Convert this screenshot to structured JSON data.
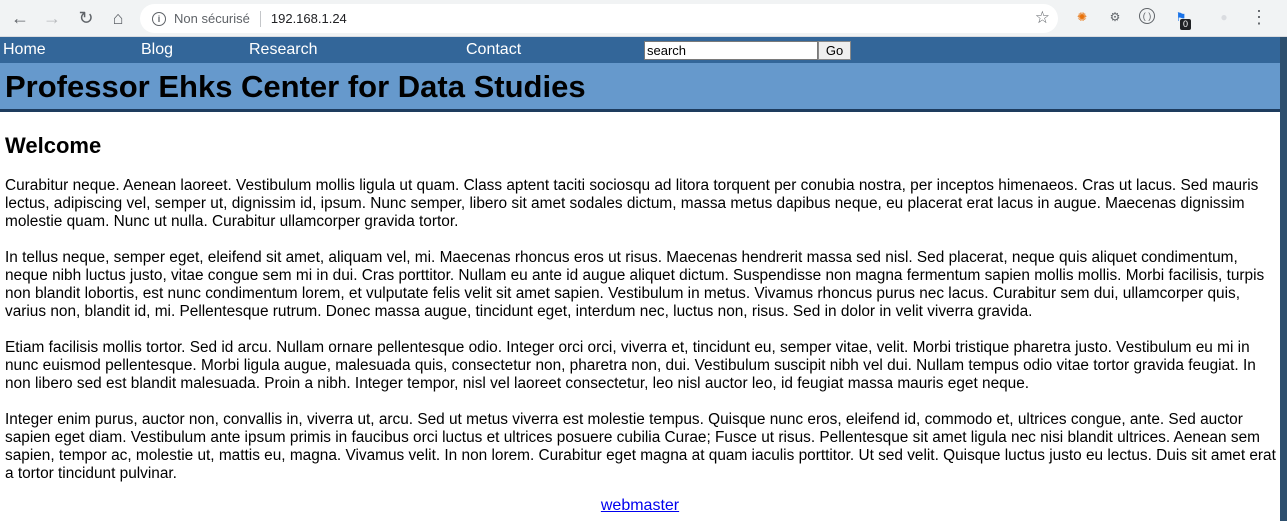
{
  "browser": {
    "security_label": "Non sécurisé",
    "url": "192.168.1.24",
    "extension_badge": "0",
    "icons": [
      "back-icon",
      "forward-icon",
      "reload-icon",
      "home-icon",
      "info-icon",
      "star-icon",
      "extension-icon",
      "menu-icon"
    ]
  },
  "nav": {
    "links": [
      "Home",
      "Blog",
      "Research",
      "Contact"
    ],
    "search_value": "search",
    "go_label": "Go"
  },
  "header": {
    "title": "Professor Ehks Center for Data Studies"
  },
  "main": {
    "heading": "Welcome",
    "paragraphs": [
      "Curabitur neque. Aenean laoreet. Vestibulum mollis ligula ut quam. Class aptent taciti sociosqu ad litora torquent per conubia nostra, per inceptos himenaeos. Cras ut lacus. Sed mauris lectus, adipiscing vel, semper ut, dignissim id, ipsum. Nunc semper, libero sit amet sodales dictum, massa metus dapibus neque, eu placerat erat lacus in augue. Maecenas dignissim molestie quam. Nunc ut nulla. Curabitur ullamcorper gravida tortor.",
      "In tellus neque, semper eget, eleifend sit amet, aliquam vel, mi. Maecenas rhoncus eros ut risus. Maecenas hendrerit massa sed nisl. Sed placerat, neque quis aliquet condimentum, neque nibh luctus justo, vitae congue sem mi in dui. Cras porttitor. Nullam eu ante id augue aliquet dictum. Suspendisse non magna fermentum sapien mollis mollis. Morbi facilisis, turpis non blandit lobortis, est nunc condimentum lorem, et vulputate felis velit sit amet sapien. Vestibulum in metus. Vivamus rhoncus purus nec lacus. Curabitur sem dui, ullamcorper quis, varius non, blandit id, mi. Pellentesque rutrum. Donec massa augue, tincidunt eget, interdum nec, luctus non, risus. Sed in dolor in velit viverra gravida.",
      "Etiam facilisis mollis tortor. Sed id arcu. Nullam ornare pellentesque odio. Integer orci orci, viverra et, tincidunt eu, semper vitae, velit. Morbi tristique pharetra justo. Vestibulum eu mi in nunc euismod pellentesque. Morbi ligula augue, malesuada quis, consectetur non, pharetra non, dui. Vestibulum suscipit nibh vel dui. Nullam tempus odio vitae tortor gravida feugiat. In non libero sed est blandit malesuada. Proin a nibh. Integer tempor, nisl vel laoreet consectetur, leo nisl auctor leo, id feugiat massa mauris eget neque.",
      "Integer enim purus, auctor non, convallis in, viverra ut, arcu. Sed ut metus viverra est molestie tempus. Quisque nunc eros, eleifend id, commodo et, ultrices congue, ante. Sed auctor sapien eget diam. Vestibulum ante ipsum primis in faucibus orci luctus et ultrices posuere cubilia Curae; Fusce ut risus. Pellentesque sit amet ligula nec nisi blandit ultrices. Aenean sem sapien, tempor ac, molestie ut, mattis eu, magna. Vivamus velit. In non lorem. Curabitur eget magna at quam iaculis porttitor. Ut sed velit. Quisque luctus justo eu lectus. Duis sit amet erat a tortor tincidunt pulvinar."
    ]
  },
  "footer": {
    "link": "webmaster"
  },
  "colors": {
    "nav_bg": "#336699",
    "header_bg": "#6699cc",
    "header_border": "#1e3c5e",
    "link": "#0000ee"
  }
}
